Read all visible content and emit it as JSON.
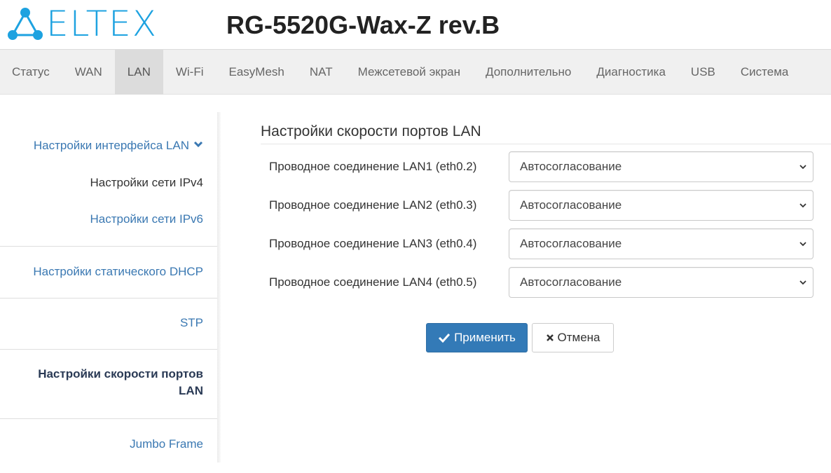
{
  "header": {
    "logo_text": "ELTEX",
    "model": "RG-5520G-Wax-Z rev.B"
  },
  "nav": {
    "items": [
      "Статус",
      "WAN",
      "LAN",
      "Wi-Fi",
      "EasyMesh",
      "NAT",
      "Межсетевой экран",
      "Дополнительно",
      "Диагностика",
      "USB",
      "Система"
    ],
    "active": "LAN"
  },
  "sidebar": {
    "lan_interface": "Настройки интерфейса LAN",
    "ipv4": "Настройки сети IPv4",
    "ipv6": "Настройки сети IPv6",
    "static_dhcp": "Настройки статического DHCP",
    "stp": "STP",
    "port_speed": "Настройки скорости портов LAN",
    "jumbo": "Jumbo Frame"
  },
  "main": {
    "title": "Настройки скорости портов LAN",
    "ports": [
      {
        "label": "Проводное соединение LAN1 (eth0.2)",
        "value": "Автосогласование"
      },
      {
        "label": "Проводное соединение LAN2 (eth0.3)",
        "value": "Автосогласование"
      },
      {
        "label": "Проводное соединение LAN3 (eth0.4)",
        "value": "Автосогласование"
      },
      {
        "label": "Проводное соединение LAN4 (eth0.5)",
        "value": "Автосогласование"
      }
    ],
    "apply_label": "Применить",
    "cancel_label": "Отмена"
  },
  "colors": {
    "brand": "#1da2e0",
    "link": "#3a78b2",
    "primary": "#337ab7"
  }
}
